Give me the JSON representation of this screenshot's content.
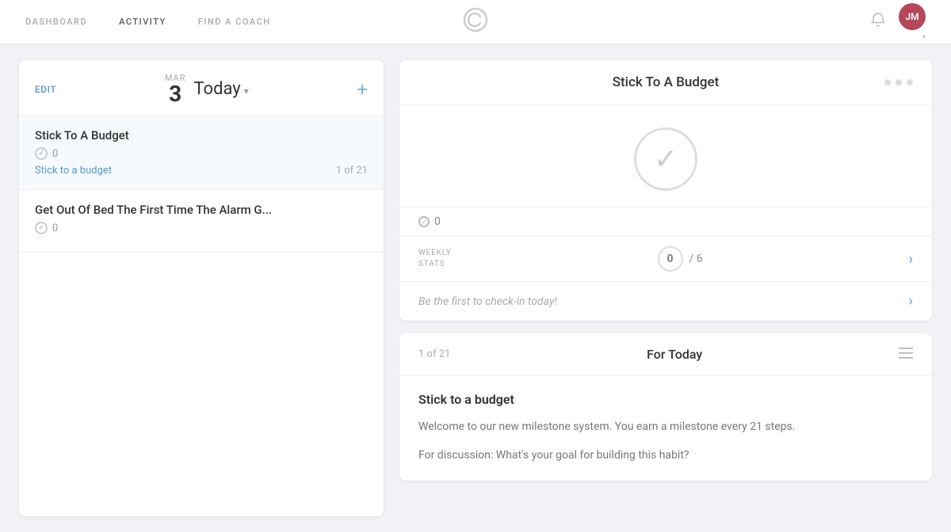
{
  "nav": {
    "links": [
      {
        "label": "DASHBOARD",
        "active": false
      },
      {
        "label": "ACTIVITY",
        "active": true
      },
      {
        "label": "FIND A COACH",
        "active": false
      }
    ],
    "logo": "©",
    "avatar_initials": "JM",
    "avatar_bg": "#b5475a"
  },
  "left": {
    "edit_label": "EDIT",
    "date_month": "MAR",
    "date_num": "3",
    "today_label": "Today",
    "add_icon": "+",
    "habits": [
      {
        "title": "Stick To A Budget",
        "count": 0,
        "link_text": "Stick to a budget",
        "progress": "1 of 21",
        "active": true
      },
      {
        "title": "Get Out Of Bed The First Time The Alarm G...",
        "count": 0,
        "link_text": "",
        "progress": "",
        "active": false
      }
    ]
  },
  "detail": {
    "title": "Stick To A Budget",
    "count": 0,
    "weekly_stats_label": "WEEKLY\nSTATS",
    "weekly_num": "0",
    "weekly_of": "/ 6",
    "checkin_text": "Be the first to check-in today!"
  },
  "bottom": {
    "position_label": "1 of 21",
    "for_today_label": "For Today",
    "milestone_title": "Stick to a budget",
    "milestone_text": "Welcome to our new milestone system. You earn a milestone every 21 steps.",
    "milestone_question": "For discussion: What's your goal for building this habit?"
  }
}
